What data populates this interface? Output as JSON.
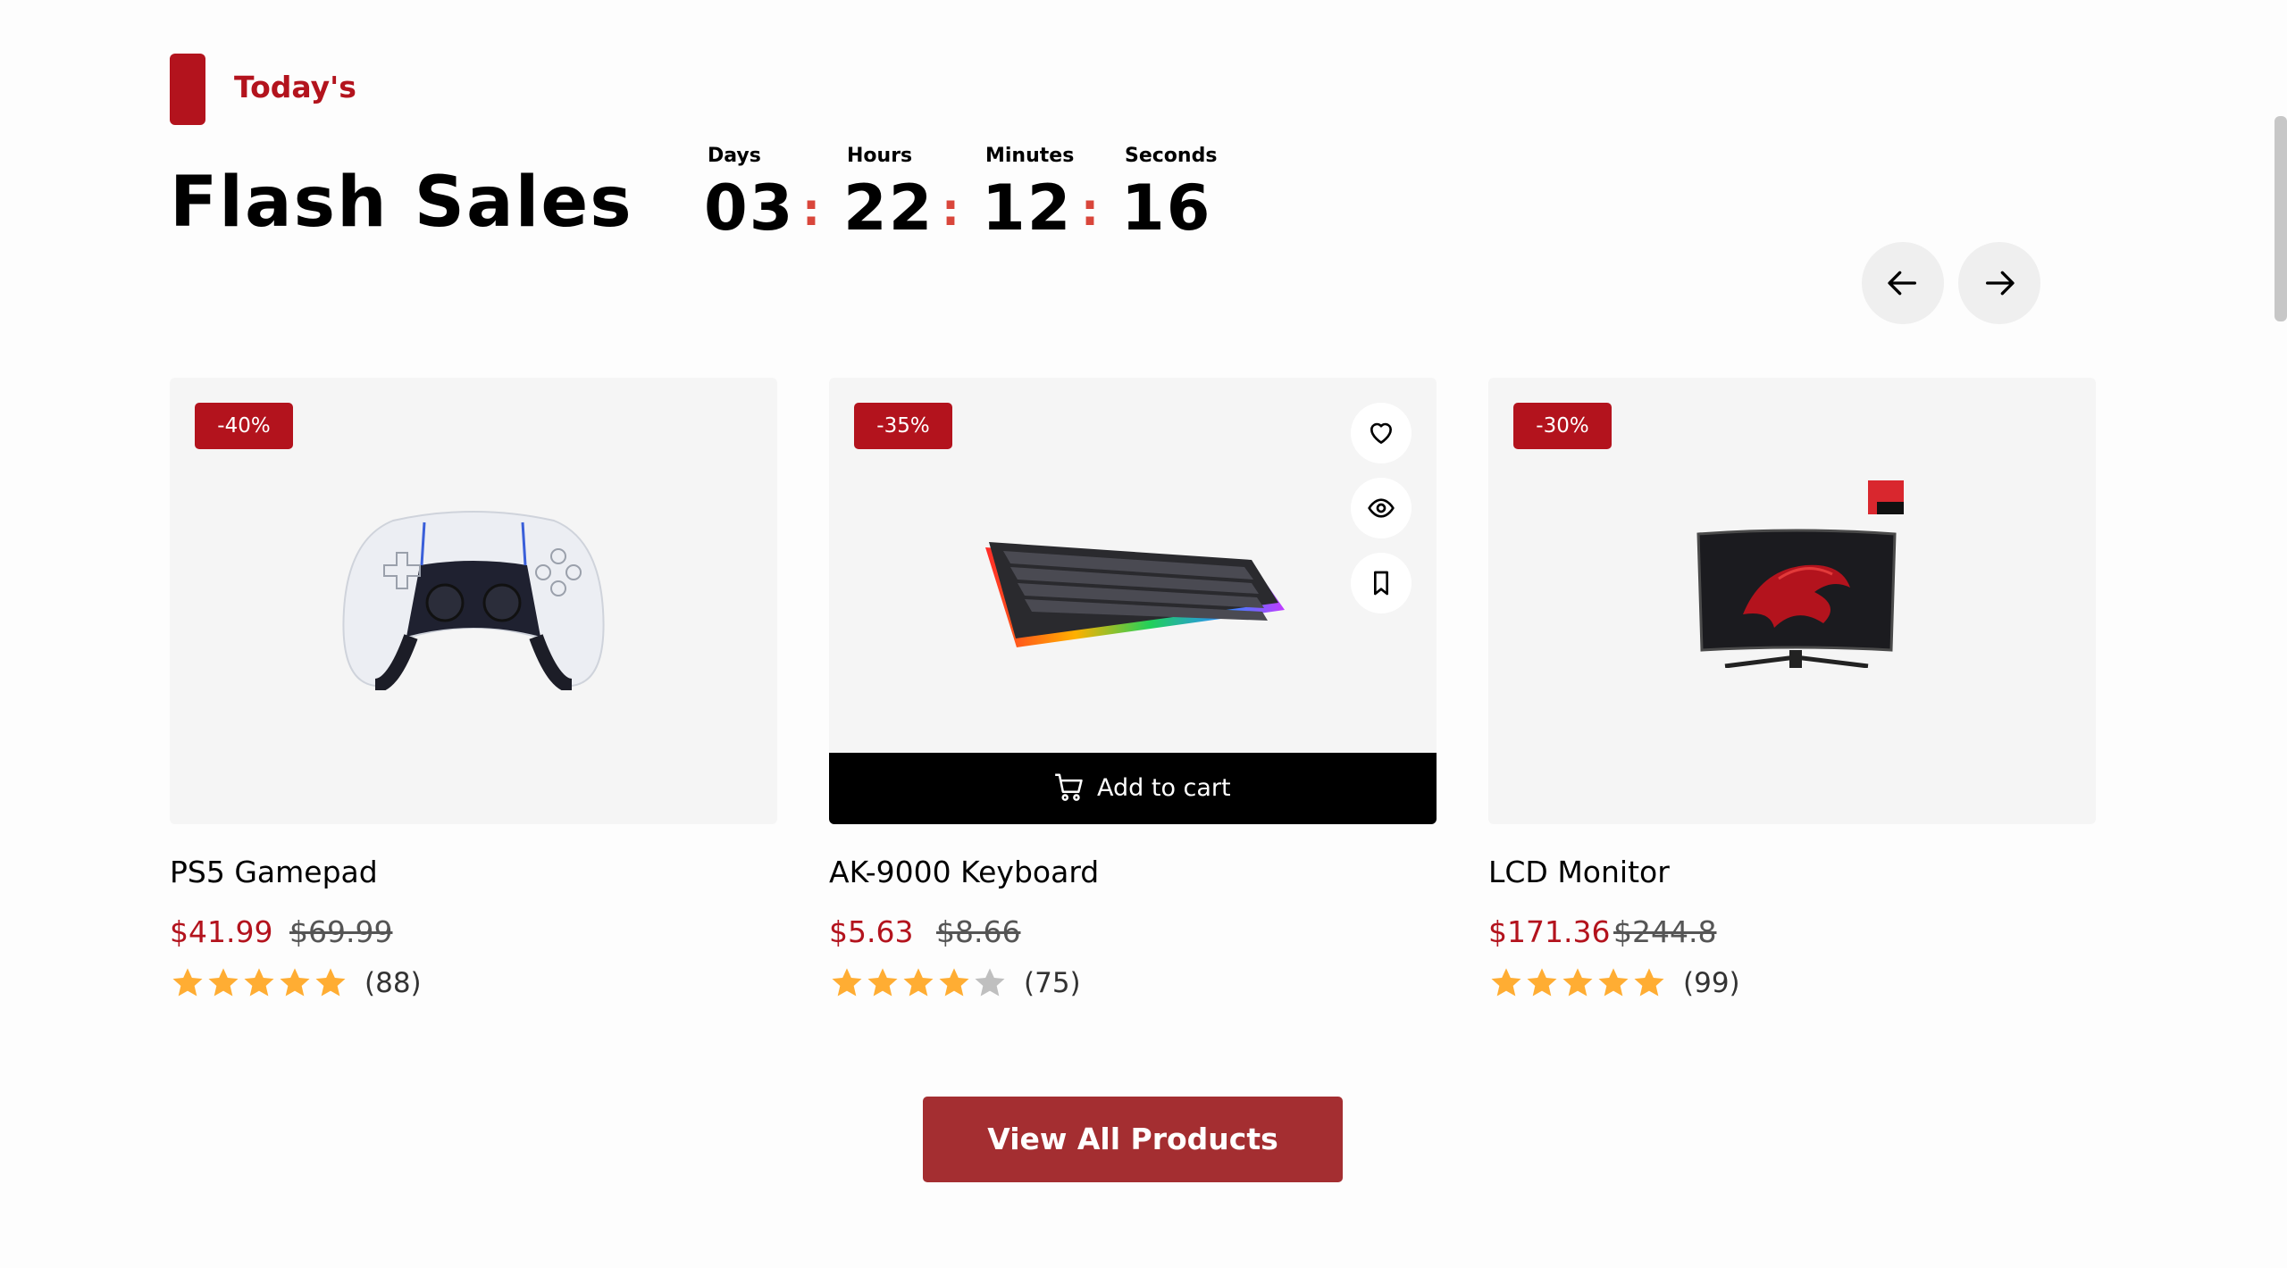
{
  "section": {
    "eyebrow": "Today's",
    "title": "Flash Sales"
  },
  "countdown": {
    "days_label": "Days",
    "days": "03",
    "hours_label": "Hours",
    "hours": "22",
    "minutes_label": "Minutes",
    "minutes": "12",
    "seconds_label": "Seconds",
    "seconds": "16",
    "separator": ":"
  },
  "products": [
    {
      "discount": "-40%",
      "name": "PS5 Gamepad",
      "price": "$41.99",
      "old_price": "$69.99",
      "rating": 5,
      "reviews": "(88)"
    },
    {
      "discount": "-35%",
      "name": "AK-9000 Keyboard",
      "price": "$5.63",
      "old_price": "$8.66",
      "rating": 4,
      "reviews": "(75)",
      "add_to_cart": "Add to cart"
    },
    {
      "discount": "-30%",
      "name": "LCD Monitor",
      "price": "$171.36",
      "old_price": "$244.8",
      "rating": 5,
      "reviews": "(99)"
    }
  ],
  "view_all": "View All Products",
  "colors": {
    "accent": "#b3131d",
    "button": "#a42e31",
    "star": "#ffad33",
    "star_empty": "#bfbfbf"
  }
}
